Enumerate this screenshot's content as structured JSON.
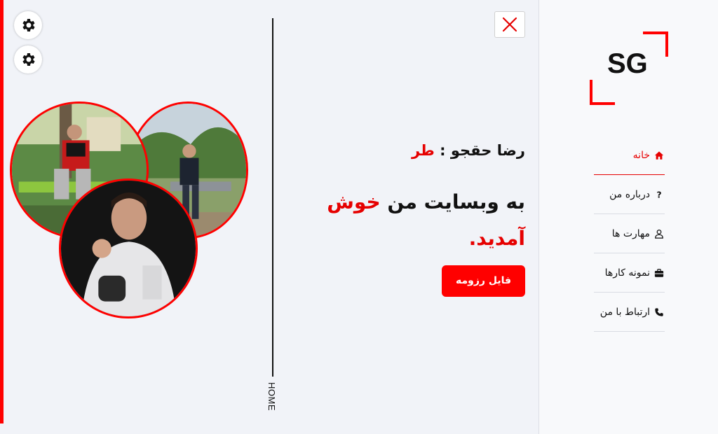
{
  "settings": {
    "buttons": [
      {
        "icon": "gear-icon"
      },
      {
        "icon": "gear-icon"
      }
    ]
  },
  "close": {
    "icon": "close-icon"
  },
  "scroll_label": "HOME",
  "hero": {
    "name": "رضا حقجو",
    "separator": " : ",
    "role": "طر",
    "welcome_part1": "به وبسایت من ",
    "welcome_accent": "خوش",
    "welcome_part2": "آمدید.",
    "cv_button": "فایل رزومه"
  },
  "sidebar": {
    "logo": "SG",
    "items": [
      {
        "label": "خانه",
        "icon": "home-icon",
        "active": true
      },
      {
        "label": "درباره من",
        "icon": "question-icon",
        "active": false
      },
      {
        "label": "مهارت ها",
        "icon": "user-icon",
        "active": false
      },
      {
        "label": "نمونه کارها",
        "icon": "briefcase-icon",
        "active": false
      },
      {
        "label": "ارتباط با من",
        "icon": "phone-icon",
        "active": false
      }
    ]
  },
  "colors": {
    "accent": "#ff0000",
    "text": "#111111",
    "background": "#f1f3f8",
    "sidebar": "#f8f9fb"
  }
}
